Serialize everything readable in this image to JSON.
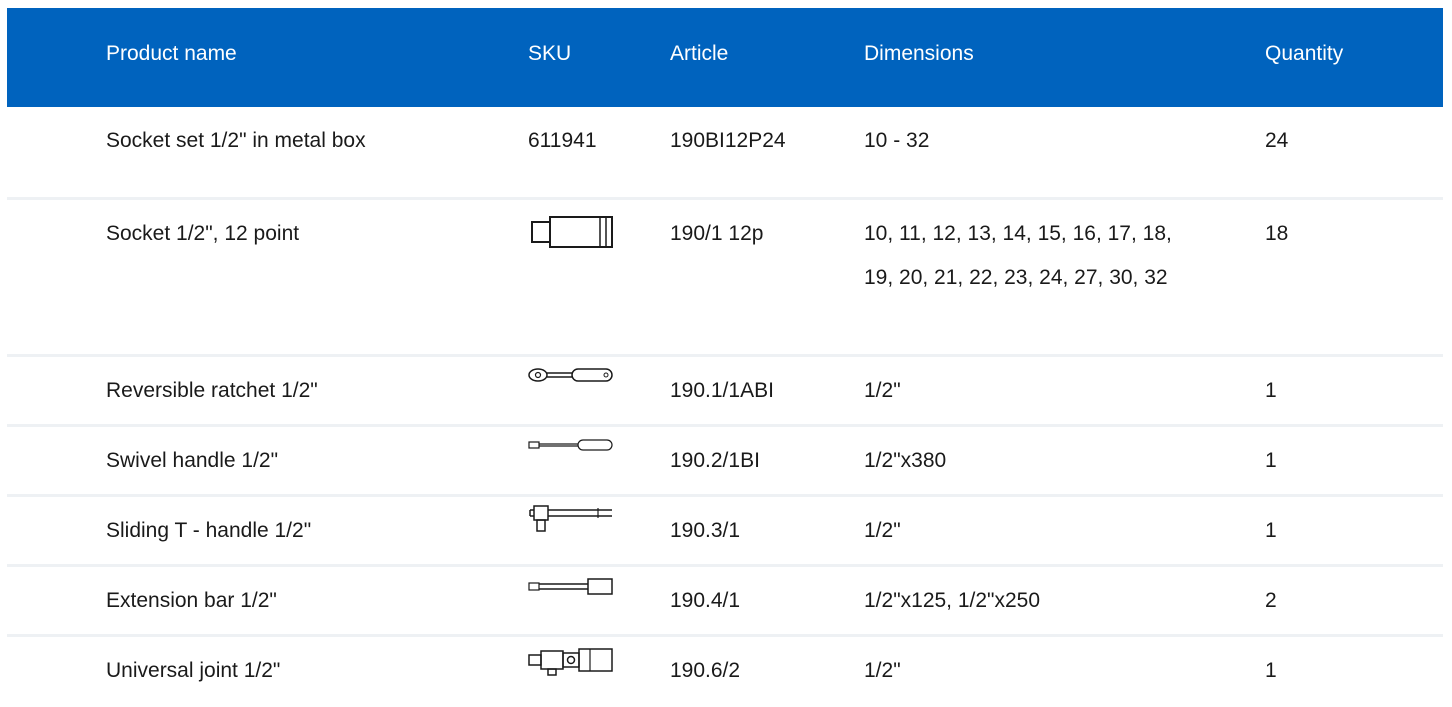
{
  "colors": {
    "header_bg": "#0063be",
    "header_text": "#ffffff",
    "row_border": "#eef1f4",
    "text": "#1a1a1a"
  },
  "table": {
    "headers": {
      "name": "Product name",
      "sku": "SKU",
      "article": "Article",
      "dimensions": "Dimensions",
      "quantity": "Quantity"
    },
    "rows": [
      {
        "name": "Socket set 1/2\" in metal box",
        "sku": "611941",
        "article": "190BI12P24",
        "dimensions": "10 - 32",
        "quantity": "24"
      },
      {
        "name": "Socket 1/2\", 12 point",
        "sku_icon": "socket-icon",
        "article": "190/1 12p",
        "dimensions": "10, 11, 12, 13, 14, 15, 16, 17, 18, 19, 20, 21, 22, 23, 24, 27, 30, 32",
        "quantity": "18"
      },
      {
        "name": "Reversible ratchet 1/2\"",
        "sku_icon": "ratchet-icon",
        "article": "190.1/1ABI",
        "dimensions": "1/2\"",
        "quantity": "1"
      },
      {
        "name": "Swivel handle 1/2\"",
        "sku_icon": "swivel-handle-icon",
        "article": "190.2/1BI",
        "dimensions": "1/2\"x380",
        "quantity": "1"
      },
      {
        "name": "Sliding T - handle 1/2\"",
        "sku_icon": "t-handle-icon",
        "article": "190.3/1",
        "dimensions": "1/2\"",
        "quantity": "1"
      },
      {
        "name": "Extension bar 1/2\"",
        "sku_icon": "extension-bar-icon",
        "article": "190.4/1",
        "dimensions": "1/2\"x125, 1/2\"x250",
        "quantity": "2"
      },
      {
        "name": "Universal joint 1/2\"",
        "sku_icon": "universal-joint-icon",
        "article": "190.6/2",
        "dimensions": "1/2\"",
        "quantity": "1"
      }
    ]
  }
}
